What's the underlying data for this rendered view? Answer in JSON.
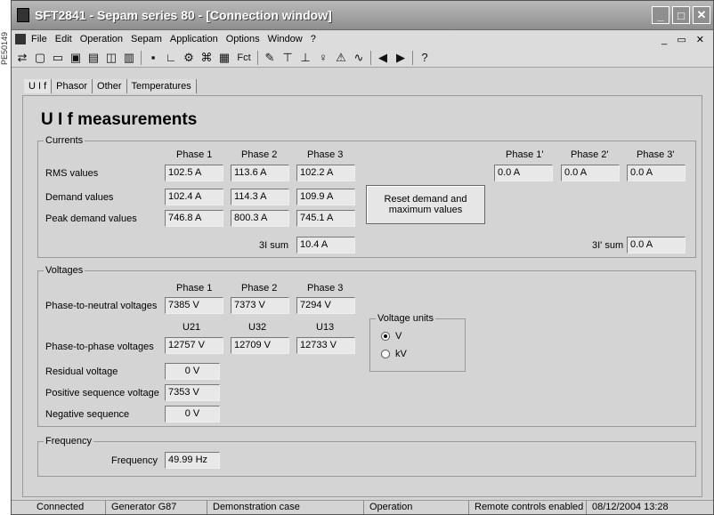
{
  "side_label": "PE50149",
  "window": {
    "title": "SFT2841 - Sepam series 80 - [Connection window]",
    "buttons": [
      "_",
      "□",
      "✕"
    ]
  },
  "menu": {
    "items": [
      "File",
      "Edit",
      "Operation",
      "Sepam",
      "Application",
      "Options",
      "Window",
      "?"
    ],
    "right": "_ ▭ ✕"
  },
  "toolbar": {
    "icons": [
      "connect-icon",
      "new-icon",
      "open-icon",
      "save-icon",
      "sepam-icon",
      "preview-icon",
      "print-icon",
      "disk-icon",
      "graph-icon",
      "settings-icon",
      "diagram-icon",
      "module-icon",
      "fct-icon",
      "wrench-icon",
      "antenna-icon",
      "tower-icon",
      "alarm-icon",
      "warning-icon",
      "wave-icon",
      "arrow-left-icon",
      "arrow-right-icon",
      "help-icon"
    ],
    "fct_label": "Fct"
  },
  "tabs": [
    "U I f",
    "Phasor",
    "Other",
    "Temperatures"
  ],
  "page_title": "U I f measurements",
  "currents": {
    "legend": "Currents",
    "headers": [
      "Phase 1",
      "Phase 2",
      "Phase 3"
    ],
    "headers_prime": [
      "Phase 1'",
      "Phase 2'",
      "Phase 3'"
    ],
    "rms_label": "RMS values",
    "rms": [
      "102.5 A",
      "113.6 A",
      "102.2 A"
    ],
    "rms_prime": [
      "0.0 A",
      "0.0 A",
      "0.0 A"
    ],
    "demand_label": "Demand values",
    "demand": [
      "102.4 A",
      "114.3 A",
      "109.9 A"
    ],
    "peak_label": "Peak demand values",
    "peak": [
      "746.8 A",
      "800.3 A",
      "745.1 A"
    ],
    "reset_button": "Reset demand and maximum values",
    "sum_label": "3I sum",
    "sum_value": "10.4 A",
    "sum_prime_label": "3I' sum",
    "sum_prime_value": "0.0 A"
  },
  "voltages": {
    "legend": "Voltages",
    "headers": [
      "Phase 1",
      "Phase 2",
      "Phase 3"
    ],
    "pn_label": "Phase-to-neutral voltages",
    "pn": [
      "7385 V",
      "7373 V",
      "7294 V"
    ],
    "pp_headers": [
      "U21",
      "U32",
      "U13"
    ],
    "pp_label": "Phase-to-phase voltages",
    "pp": [
      "12757 V",
      "12709 V",
      "12733 V"
    ],
    "residual_label": "Residual voltage",
    "residual": "0 V",
    "positive_label": "Positive sequence voltage",
    "positive": "7353 V",
    "negative_label": "Negative sequence",
    "negative": "0 V",
    "units_legend": "Voltage units",
    "unit_v": "V",
    "unit_kv": "kV",
    "unit_selected": "V"
  },
  "frequency": {
    "legend": "Frequency",
    "label": "Frequency",
    "value": "49.99 Hz"
  },
  "status": {
    "connected": "Connected",
    "generator": "Generator G87",
    "demo": "Demonstration case",
    "mode": "Operation",
    "remote": "Remote controls enabled",
    "datetime": "08/12/2004 13:28"
  }
}
